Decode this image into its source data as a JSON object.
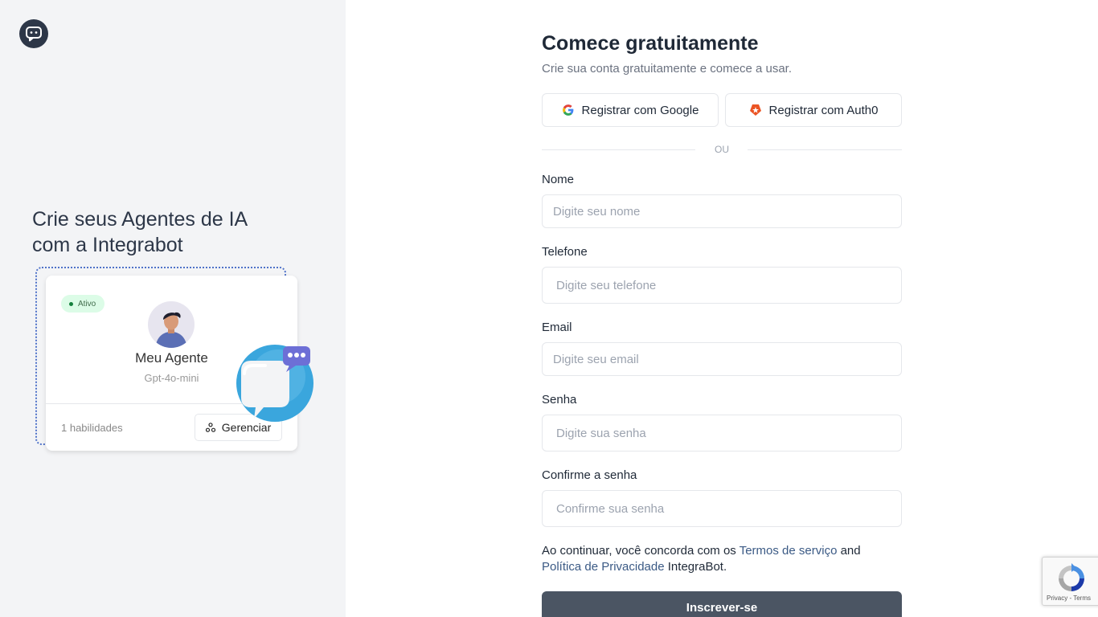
{
  "brand": {
    "icon": "chat-bubble-icon"
  },
  "hero": {
    "line1": "Crie seus Agentes de IA",
    "line2": "com a Integrabot"
  },
  "agent_card": {
    "status": "Ativo",
    "name": "Meu Agente",
    "model": "Gpt-4o-mini",
    "skills": "1 habilidades",
    "manage_label": "Gerenciar"
  },
  "form": {
    "title": "Comece gratuitamente",
    "subtitle": "Crie sua conta gratuitamente e comece a usar.",
    "google_label": "Registrar com Google",
    "auth0_label": "Registrar com Auth0",
    "divider": "OU",
    "fields": {
      "name": {
        "label": "Nome",
        "placeholder": "Digite seu nome"
      },
      "phone": {
        "label": "Telefone",
        "placeholder": "Digite seu telefone"
      },
      "email": {
        "label": "Email",
        "placeholder": "Digite seu email"
      },
      "password": {
        "label": "Senha",
        "placeholder": "Digite sua senha"
      },
      "confirm": {
        "label": "Confirme a senha",
        "placeholder": "Confirme sua senha"
      }
    },
    "terms": {
      "before": "Ao continuar, você concorda com os ",
      "terms_link": "Termos de serviço",
      "middle": " and",
      "privacy_link": "Política de Privacidade",
      "after": " IntegraBot."
    },
    "submit_label": "Inscrever-se"
  },
  "recaptcha": {
    "privacy": "Privacy",
    "separator": " - ",
    "terms": "Terms"
  },
  "colors": {
    "panel_bg": "#f3f4f6",
    "primary_button": "#4b5563",
    "link": "#3b5a85",
    "status_badge": "#dcfce7"
  }
}
